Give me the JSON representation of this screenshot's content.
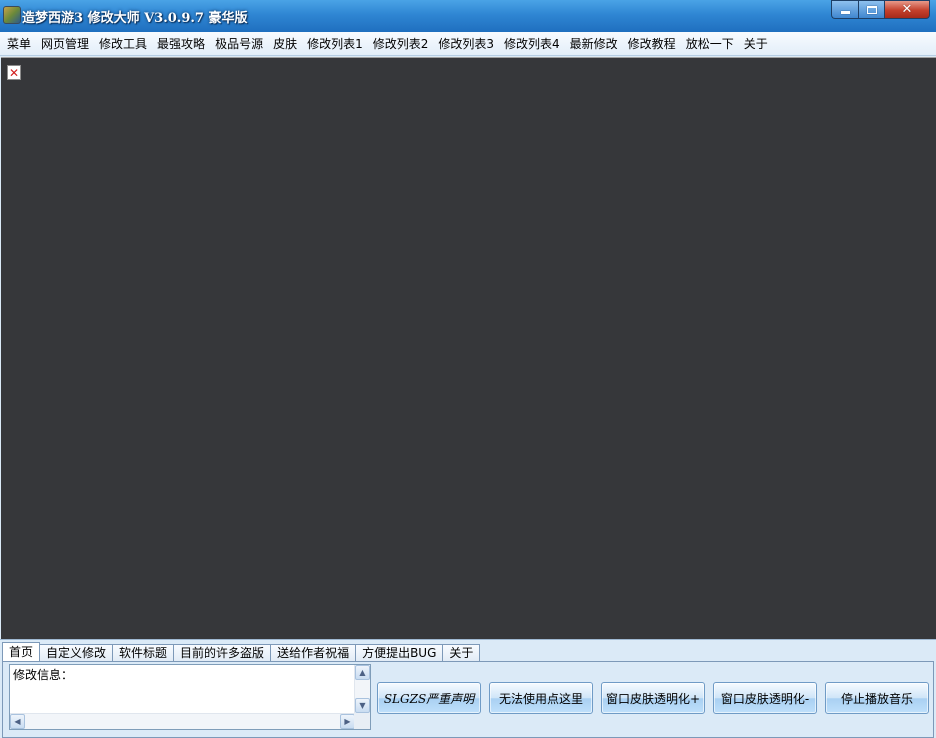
{
  "window": {
    "title": "造梦西游3 修改大师 V3.0.9.7 豪华版",
    "controls": {
      "minimize": "minimize",
      "maximize": "maximize",
      "close": "✕"
    }
  },
  "menu": {
    "items": [
      "菜单",
      "网页管理",
      "修改工具",
      "最强攻略",
      "极品号源",
      "皮肤",
      "修改列表1",
      "修改列表2",
      "修改列表3",
      "修改列表4",
      "最新修改",
      "修改教程",
      "放松一下",
      "关于"
    ]
  },
  "viewport": {
    "broken_image_icon": "✕",
    "background_color": "#36373a"
  },
  "tabs": {
    "items": [
      "首页",
      "自定义修改",
      "软件标题",
      "目前的许多盗版",
      "送给作者祝福",
      "方便提出BUG",
      "关于"
    ],
    "active_index": 0
  },
  "log": {
    "label": "修改信息："
  },
  "scrollbars": {
    "up": "▲",
    "down": "▼",
    "left": "◀",
    "right": "▶"
  },
  "actions": {
    "declaration": "SLGZS严重声明",
    "cannot_use": "无法使用点这里",
    "transparency_up": "窗口皮肤透明化+",
    "transparency_down": "窗口皮肤透明化-",
    "stop_music": "停止播放音乐"
  },
  "colors": {
    "titlebar": "#2f86d3",
    "close_button": "#c4402c",
    "panel": "#dbeaf7"
  }
}
